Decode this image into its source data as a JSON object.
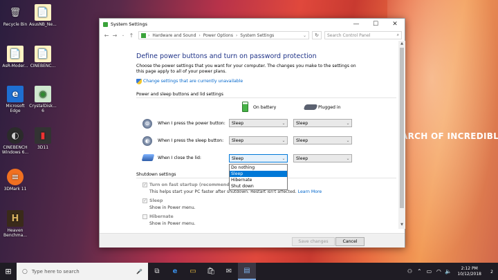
{
  "desktop": {
    "background_text": "ARCH OF INCREDIBLE",
    "icons": [
      {
        "label": "Recycle Bin",
        "glyph": "🗑"
      },
      {
        "label": "AsusNB_Ne...",
        "glyph": "📄"
      },
      {
        "label": "AsR-Moder...",
        "glyph": "📄"
      },
      {
        "label": "CINEBENC...",
        "glyph": "📄"
      },
      {
        "label": "Microsoft\nEdge",
        "glyph": "e"
      },
      {
        "label": "CrystalDisk...\n6",
        "glyph": "◉"
      },
      {
        "label": "CINEBENCH\nWindows 6...",
        "glyph": "◐"
      },
      {
        "label": "3D11",
        "glyph": "▮"
      },
      {
        "label": "3DMark 11",
        "glyph": "≡"
      },
      {
        "label": "Heaven\nBenchma...",
        "glyph": "H"
      }
    ]
  },
  "window": {
    "title": "System Settings",
    "controls": {
      "minimize": "—",
      "maximize": "☐",
      "close": "✕"
    },
    "address": {
      "breadcrumbs": [
        "Hardware and Sound",
        "Power Options",
        "System Settings"
      ],
      "separator": "›",
      "search_placeholder": "Search Control Panel"
    }
  },
  "page": {
    "heading": "Define power buttons and turn on password protection",
    "description": "Choose the power settings that you want for your computer. The changes you make to the settings on this page apply to all of your power plans.",
    "change_link": "Change settings that are currently unavailable",
    "section1_label": "Power and sleep buttons and lid settings",
    "col_on_battery": "On battery",
    "col_plugged_in": "Plugged in",
    "rows": [
      {
        "label": "When I press the power button:",
        "battery": "Sleep",
        "plugged": "Sleep"
      },
      {
        "label": "When I press the sleep button:",
        "battery": "Sleep",
        "plugged": "Sleep"
      },
      {
        "label": "When I close the lid:",
        "battery": "Sleep",
        "plugged": "Sleep"
      }
    ],
    "dropdown_options": [
      "Do nothing",
      "Sleep",
      "Hibernate",
      "Shut down"
    ],
    "dropdown_selected_index": 1,
    "section2_label": "Shutdown settings",
    "shutdown": [
      {
        "label": "Turn on fast startup (recommended)",
        "checked": true,
        "desc": "This helps start your PC faster after shutdown. Restart isn't affected.",
        "link": "Learn More"
      },
      {
        "label": "Sleep",
        "checked": true,
        "desc": "Show in Power menu."
      },
      {
        "label": "Hibernate",
        "checked": false,
        "desc": "Show in Power menu."
      }
    ],
    "save_label": "Save changes",
    "cancel_label": "Cancel"
  },
  "taskbar": {
    "search_placeholder": "Type here to search",
    "time": "2:12 PM",
    "date": "10/12/2018",
    "notification_count": "2"
  }
}
